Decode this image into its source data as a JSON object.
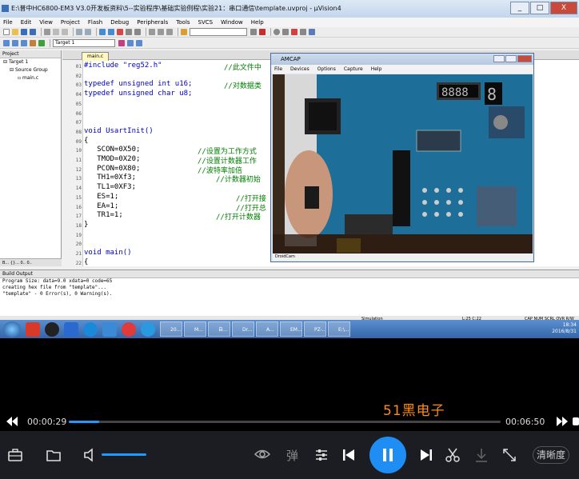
{
  "window": {
    "title": "E:\\普中HC6800-EM3 V3.0开发板资料\\5--实验程序\\基础实验例程\\实验21：串口通信\\template.uvproj - µVision4",
    "controls": [
      "_",
      "□",
      "X"
    ]
  },
  "menubar": [
    "File",
    "Edit",
    "View",
    "Project",
    "Flash",
    "Debug",
    "Peripherals",
    "Tools",
    "SVCS",
    "Window",
    "Help"
  ],
  "toolbar": {
    "target": "Target 1"
  },
  "project": {
    "header": "Project",
    "items": [
      "Target 1",
      "Source Group",
      "main.c"
    ],
    "tabs": "B... {}... 0.. 0.."
  },
  "editor": {
    "tab": "main.c",
    "line_numbers": [
      "01",
      "02",
      "03",
      "04",
      "05",
      "06",
      "07",
      "08",
      "09",
      "10",
      "11",
      "12",
      "13",
      "14",
      "15",
      "16",
      "17",
      "18",
      "19",
      "20",
      "21",
      "22"
    ],
    "lines": [
      {
        "code": "#include \"reg52.h\"",
        "comment": "//此文件中"
      },
      {
        "code": "",
        "comment": ""
      },
      {
        "code": "typedef unsigned int u16;",
        "comment": "//对数据类"
      },
      {
        "code": "typedef unsigned char u8;",
        "comment": ""
      },
      {
        "code": "",
        "comment": ""
      },
      {
        "code": "",
        "comment": ""
      },
      {
        "code": "",
        "comment": ""
      },
      {
        "code": "void UsartInit()",
        "comment": ""
      },
      {
        "code": "{",
        "comment": ""
      },
      {
        "code": "   SCON=0X50;",
        "comment": "//设置为工作方式"
      },
      {
        "code": "   TMOD=0X20;",
        "comment": "//设置计数器工作"
      },
      {
        "code": "   PCON=0X80;",
        "comment": "//波特率加倍"
      },
      {
        "code": "   TH1=0Xf3;",
        "comment": "//计数器初始"
      },
      {
        "code": "   TL1=0XF3;",
        "comment": ""
      },
      {
        "code": "   ES=1;",
        "comment": "//打开接"
      },
      {
        "code": "   EA=1;",
        "comment": "//打开总"
      },
      {
        "code": "   TR1=1;",
        "comment": "//打开计数器"
      },
      {
        "code": "}",
        "comment": ""
      },
      {
        "code": "",
        "comment": ""
      },
      {
        "code": "",
        "comment": ""
      },
      {
        "code": "void main()",
        "comment": ""
      },
      {
        "code": "{",
        "comment": ""
      }
    ]
  },
  "amcap": {
    "title": "AMCAP",
    "menu": [
      "File",
      "Devices",
      "Options",
      "Capture",
      "Help"
    ],
    "status": "DroidCam"
  },
  "build_output": {
    "header": "Build Output",
    "lines": [
      "Program Size: data=9.0 xdata=0 code=65",
      "creating hex file from \"template\"...",
      "\"template\" - 0 Error(s), 0 Warning(s)."
    ]
  },
  "statusbar": {
    "mode": "Simulation",
    "pos": "L:25 C:22",
    "flags": "CAP  NUM  SCRL  OVR  R/W"
  },
  "taskbar": {
    "windows": [
      "20...",
      "M...",
      "自...",
      "Dr...",
      "A...",
      "EM...",
      "PZ-...",
      "E:\\..."
    ],
    "time": "18:34",
    "date": "2016/8/31"
  },
  "player": {
    "watermark": "51黑电子",
    "elapsed": "00:00:29",
    "duration": "00:06:50",
    "progress": 0.07,
    "volume": 0.85,
    "danmaku_label": "弹",
    "quality_label": "清晰度"
  },
  "colors": {
    "accent": "#1e8ef5",
    "watermark": "#ff8a1c",
    "keyword": "#0000c0",
    "comment": "#008000"
  }
}
